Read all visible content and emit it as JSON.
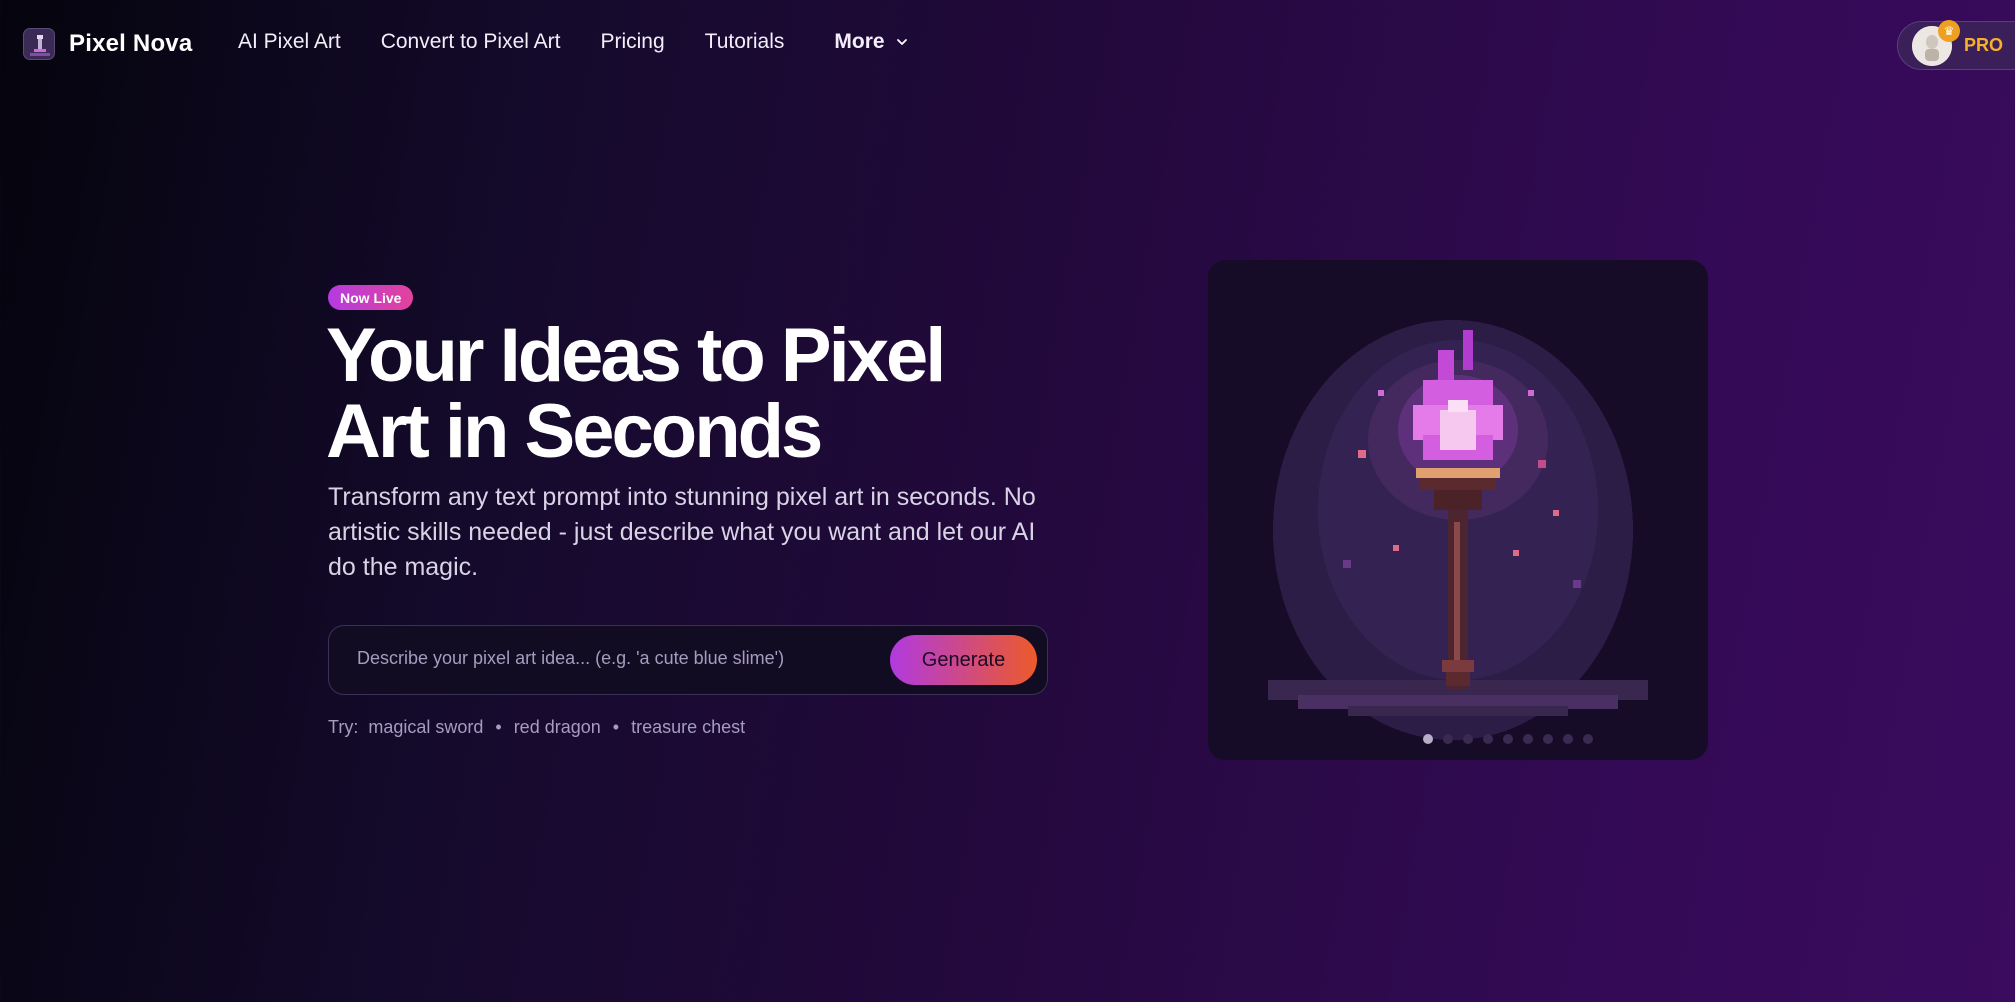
{
  "nav": {
    "brand": "Pixel Nova",
    "links": [
      "AI Pixel Art",
      "Convert to Pixel Art",
      "Pricing",
      "Tutorials"
    ],
    "more_label": "More",
    "pro_label": "PRO"
  },
  "hero": {
    "badge": "Now Live",
    "title_line1": "Your Ideas to Pixel",
    "title_line2": "Art in Seconds",
    "subtitle": "Transform any text prompt into stunning pixel art in seconds. No artistic skills needed - just describe what you want and let our AI do the magic.",
    "prompt_placeholder": "Describe your pixel art idea... (e.g. 'a cute blue slime')",
    "generate_label": "Generate",
    "try_label": "Try:",
    "suggestions": [
      "magical sword",
      "red dragon",
      "treasure chest"
    ]
  },
  "showcase": {
    "slide_count": 9,
    "active_slide": 1
  },
  "colors": {
    "accent_gradient_start": "#b13ae0",
    "accent_gradient_end": "#ec5a2a",
    "pro_gold": "#f5b02c"
  },
  "icons": {
    "brand": "pixel-logo-icon",
    "more": "chevron-down-icon",
    "avatar": "user-avatar-icon",
    "crown": "crown-icon"
  }
}
